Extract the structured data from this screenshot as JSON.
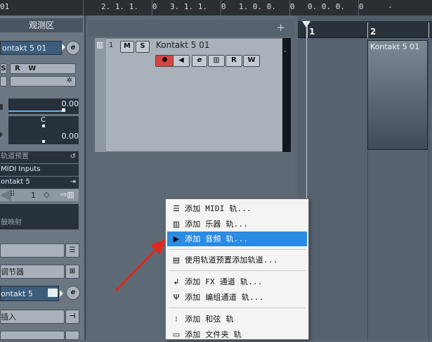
{
  "topbar": {
    "positions": [
      "01",
      "2. 1. 1.   0",
      "3. 1. 1.   0",
      "1. 0. 0.   0",
      "0. 0. 0.   0",
      "-"
    ]
  },
  "inspector": {
    "title": "观测区",
    "track_name": "ontakt 5 01",
    "s_btn": "S",
    "r_btn": "R",
    "w_btn": "W",
    "value_top": "0.00",
    "value_mid_label": "C",
    "value_bottom": "0.00",
    "preset_label": "轨道预置",
    "midi_input": "MIDI Inputs",
    "instrument": "ontakt 5",
    "channel": "1",
    "mapping_label": "鼓映射",
    "section_eq": "调节器",
    "section_instrument": "ontakt 5",
    "section_inserts": "插入"
  },
  "track": {
    "number": "1",
    "mute": "M",
    "solo": "S",
    "name": "Kontakt 5 01",
    "read": "R",
    "write": "W",
    "meter_mark": "-"
  },
  "ruler": {
    "bars": [
      "1",
      "2"
    ]
  },
  "clip": {
    "label": "Kontakt 5 01"
  },
  "menu": {
    "items": [
      {
        "icon": "midi-track-icon",
        "label": "添加 MIDI 轨..."
      },
      {
        "icon": "instrument-track-icon",
        "label": "添加 乐器 轨..."
      },
      {
        "icon": "audio-track-icon",
        "label": "添加 音频 轨..."
      },
      {
        "icon": "track-preset-icon",
        "label": "使用轨道预置添加轨道..."
      },
      {
        "icon": "fx-channel-icon",
        "label": "添加 FX 通道 轨..."
      },
      {
        "icon": "group-channel-icon",
        "label": "添加 编组通道 轨..."
      },
      {
        "icon": "chord-track-icon",
        "label": "添加 和弦 轨"
      },
      {
        "icon": "folder-track-icon",
        "label": "添加 文件夹 轨"
      }
    ],
    "selected_index": 2
  },
  "colors": {
    "selection": "#2b8ae1",
    "record": "#d64545",
    "arrow": "#e0281f"
  }
}
